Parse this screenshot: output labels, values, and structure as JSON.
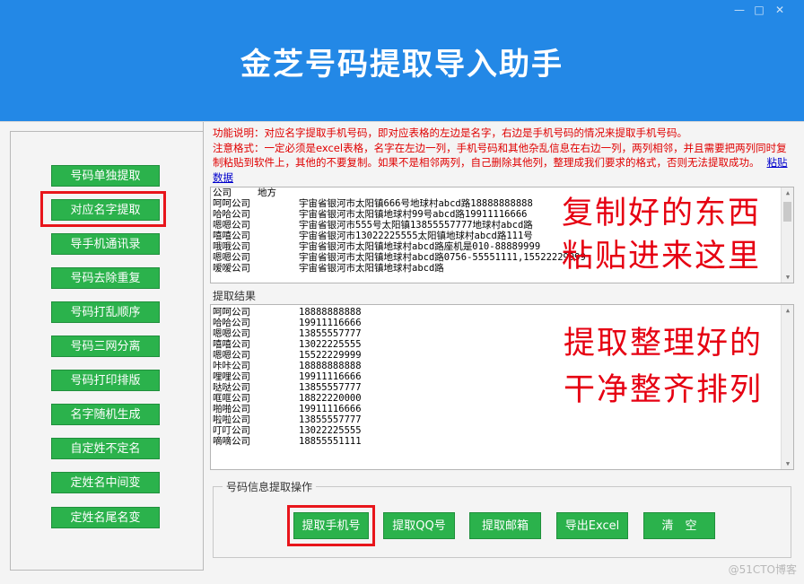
{
  "window": {
    "title": "金芝号码提取导入助手",
    "controls": [
      "—",
      "□",
      "✕"
    ]
  },
  "sidebar": {
    "items": [
      {
        "label": "号码单独提取"
      },
      {
        "label": "对应名字提取"
      },
      {
        "label": "导手机通讯录"
      },
      {
        "label": "号码去除重复"
      },
      {
        "label": "号码打乱顺序"
      },
      {
        "label": "号码三网分离"
      },
      {
        "label": "号码打印排版"
      },
      {
        "label": "名字随机生成"
      },
      {
        "label": "自定姓不定名"
      },
      {
        "label": "定姓名中间变"
      },
      {
        "label": "定姓名尾名变"
      }
    ]
  },
  "notice": {
    "line1": "功能说明：对应名字提取手机号码，即对应表格的左边是名字，右边是手机号码的情况来提取手机号码。",
    "line2": "注意格式：一定必须是excel表格，名字在左边一列，手机号码和其他杂乱信息在右边一列，两列相邻，并且需要把两列同时复制粘贴到软件上，其他的不要复制。如果不是相邻两列，自己删除其他列，整理成我们要求的格式，否则无法提取成功。",
    "paste_link": "粘贴数据"
  },
  "input_box": {
    "rows": [
      [
        "公司",
        "地方"
      ],
      [
        "呵呵公司",
        "宇宙省银河市太阳镇666号地球村abcd路18888888888"
      ],
      [
        "哈哈公司",
        "宇宙省银河市太阳镇地球村99号abcd路19911116666"
      ],
      [
        "嗯嗯公司",
        "宇宙省银河市555号太阳镇13855557777地球村abcd路"
      ],
      [
        "嘻嘻公司",
        "宇宙省银河市13022225555太阳镇地球村abcd路111号"
      ],
      [
        "哦哦公司",
        "宇宙省银河市太阳镇地球村abcd路座机是010-88889999"
      ],
      [
        "嗯嗯公司",
        "宇宙省银河市太阳镇地球村abcd路0756-55551111,15522229999"
      ],
      [
        "嗳嗳公司",
        "宇宙省银河市太阳镇地球村abcd路"
      ]
    ],
    "overlay_line1": "复制好的东西",
    "overlay_line2": "粘贴进来这里"
  },
  "result": {
    "label": "提取结果",
    "rows": [
      [
        "呵呵公司",
        "18888888888"
      ],
      [
        "哈哈公司",
        "19911116666"
      ],
      [
        "嗯嗯公司",
        "13855557777"
      ],
      [
        "嘻嘻公司",
        "13022225555"
      ],
      [
        "嗯嗯公司",
        "15522229999"
      ],
      [
        "咔咔公司",
        "18888888888"
      ],
      [
        "哩哩公司",
        "19911116666"
      ],
      [
        "哒哒公司",
        "13855557777"
      ],
      [
        "哐哐公司",
        "18822220000"
      ],
      [
        "啪啪公司",
        "19911116666"
      ],
      [
        "啦啦公司",
        "13855557777"
      ],
      [
        "叮叮公司",
        "13022225555"
      ],
      [
        "嘀嘀公司",
        "18855551111"
      ]
    ],
    "overlay_line1": "提取整理好的",
    "overlay_line2": "干净整齐排列"
  },
  "operations": {
    "group_label": "号码信息提取操作",
    "buttons": [
      {
        "label": "提取手机号"
      },
      {
        "label": "提取QQ号"
      },
      {
        "label": "提取邮箱"
      },
      {
        "label": "导出Excel"
      },
      {
        "label": "清　空"
      }
    ]
  },
  "watermark": "@51CTO博客"
}
